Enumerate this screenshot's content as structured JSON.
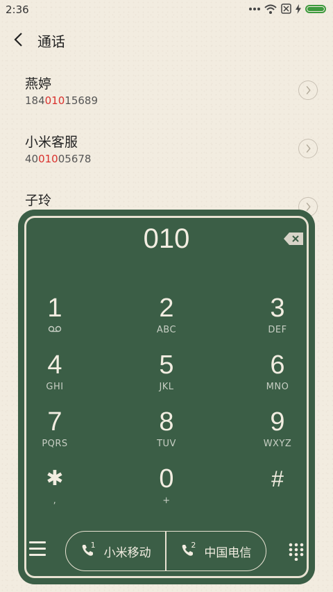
{
  "status_bar": {
    "time": "2:36",
    "icons": [
      "more-dots-icon",
      "wifi-icon",
      "no-sim-icon",
      "charging-icon",
      "battery-icon"
    ],
    "battery_color": "#3d9a3d"
  },
  "header": {
    "title": "通话",
    "back_icon": "chevron-left-icon"
  },
  "contacts": [
    {
      "name": "燕婷",
      "number_before": "184",
      "number_match": "010",
      "number_after": "15689"
    },
    {
      "name": "小米客服",
      "number_before": "40",
      "number_match": "010",
      "number_after": "05678"
    },
    {
      "name": "子玲",
      "number_before": "",
      "number_match": "",
      "number_after": ""
    }
  ],
  "dialpad": {
    "display": "010",
    "background": "#3b5e46",
    "keys": [
      {
        "digit": "1",
        "letters": ""
      },
      {
        "digit": "2",
        "letters": "ABC"
      },
      {
        "digit": "3",
        "letters": "DEF"
      },
      {
        "digit": "4",
        "letters": "GHI"
      },
      {
        "digit": "5",
        "letters": "JKL"
      },
      {
        "digit": "6",
        "letters": "MNO"
      },
      {
        "digit": "7",
        "letters": "PQRS"
      },
      {
        "digit": "8",
        "letters": "TUV"
      },
      {
        "digit": "9",
        "letters": "WXYZ"
      },
      {
        "digit": "✱",
        "letters": ","
      },
      {
        "digit": "0",
        "letters": "+"
      },
      {
        "digit": "#",
        "letters": ""
      }
    ],
    "sim1": {
      "label": "小米移动",
      "slot": "1"
    },
    "sim2": {
      "label": "中国电信",
      "slot": "2"
    }
  }
}
